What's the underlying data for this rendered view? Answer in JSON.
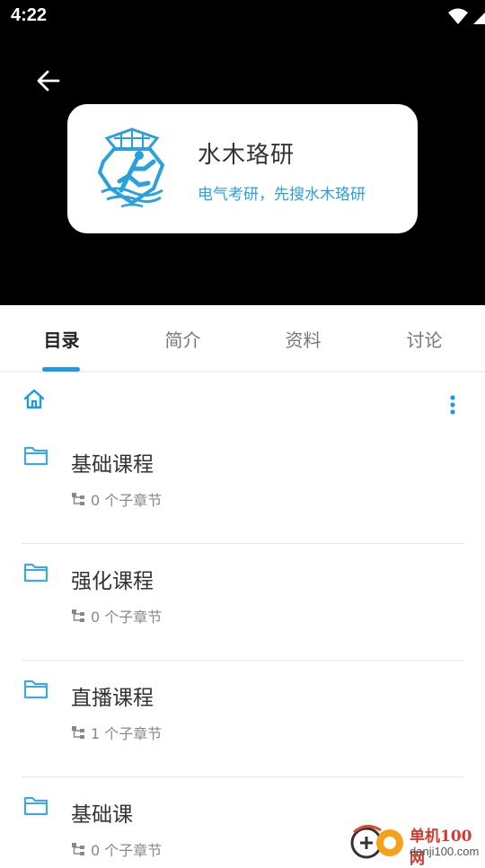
{
  "status_bar": {
    "time": "4:22"
  },
  "header": {
    "card": {
      "title": "水木珞研",
      "subtitle": "电气考研，先搜水木珞研"
    }
  },
  "tabs": [
    {
      "label": "目录",
      "active": true
    },
    {
      "label": "简介",
      "active": false
    },
    {
      "label": "资料",
      "active": false
    },
    {
      "label": "讨论",
      "active": false
    }
  ],
  "items": [
    {
      "title": "基础课程",
      "meta": "0 个子章节"
    },
    {
      "title": "强化课程",
      "meta": "0 个子章节"
    },
    {
      "title": "直播课程",
      "meta": "1 个子章节"
    },
    {
      "title": "基础课",
      "meta": "0 个子章节"
    }
  ],
  "watermark": {
    "brand": "单机100网",
    "domain": "danji100.com"
  },
  "colors": {
    "accent": "#1e9be0",
    "folder": "#3ea8e4",
    "header_bg": "#000000"
  }
}
